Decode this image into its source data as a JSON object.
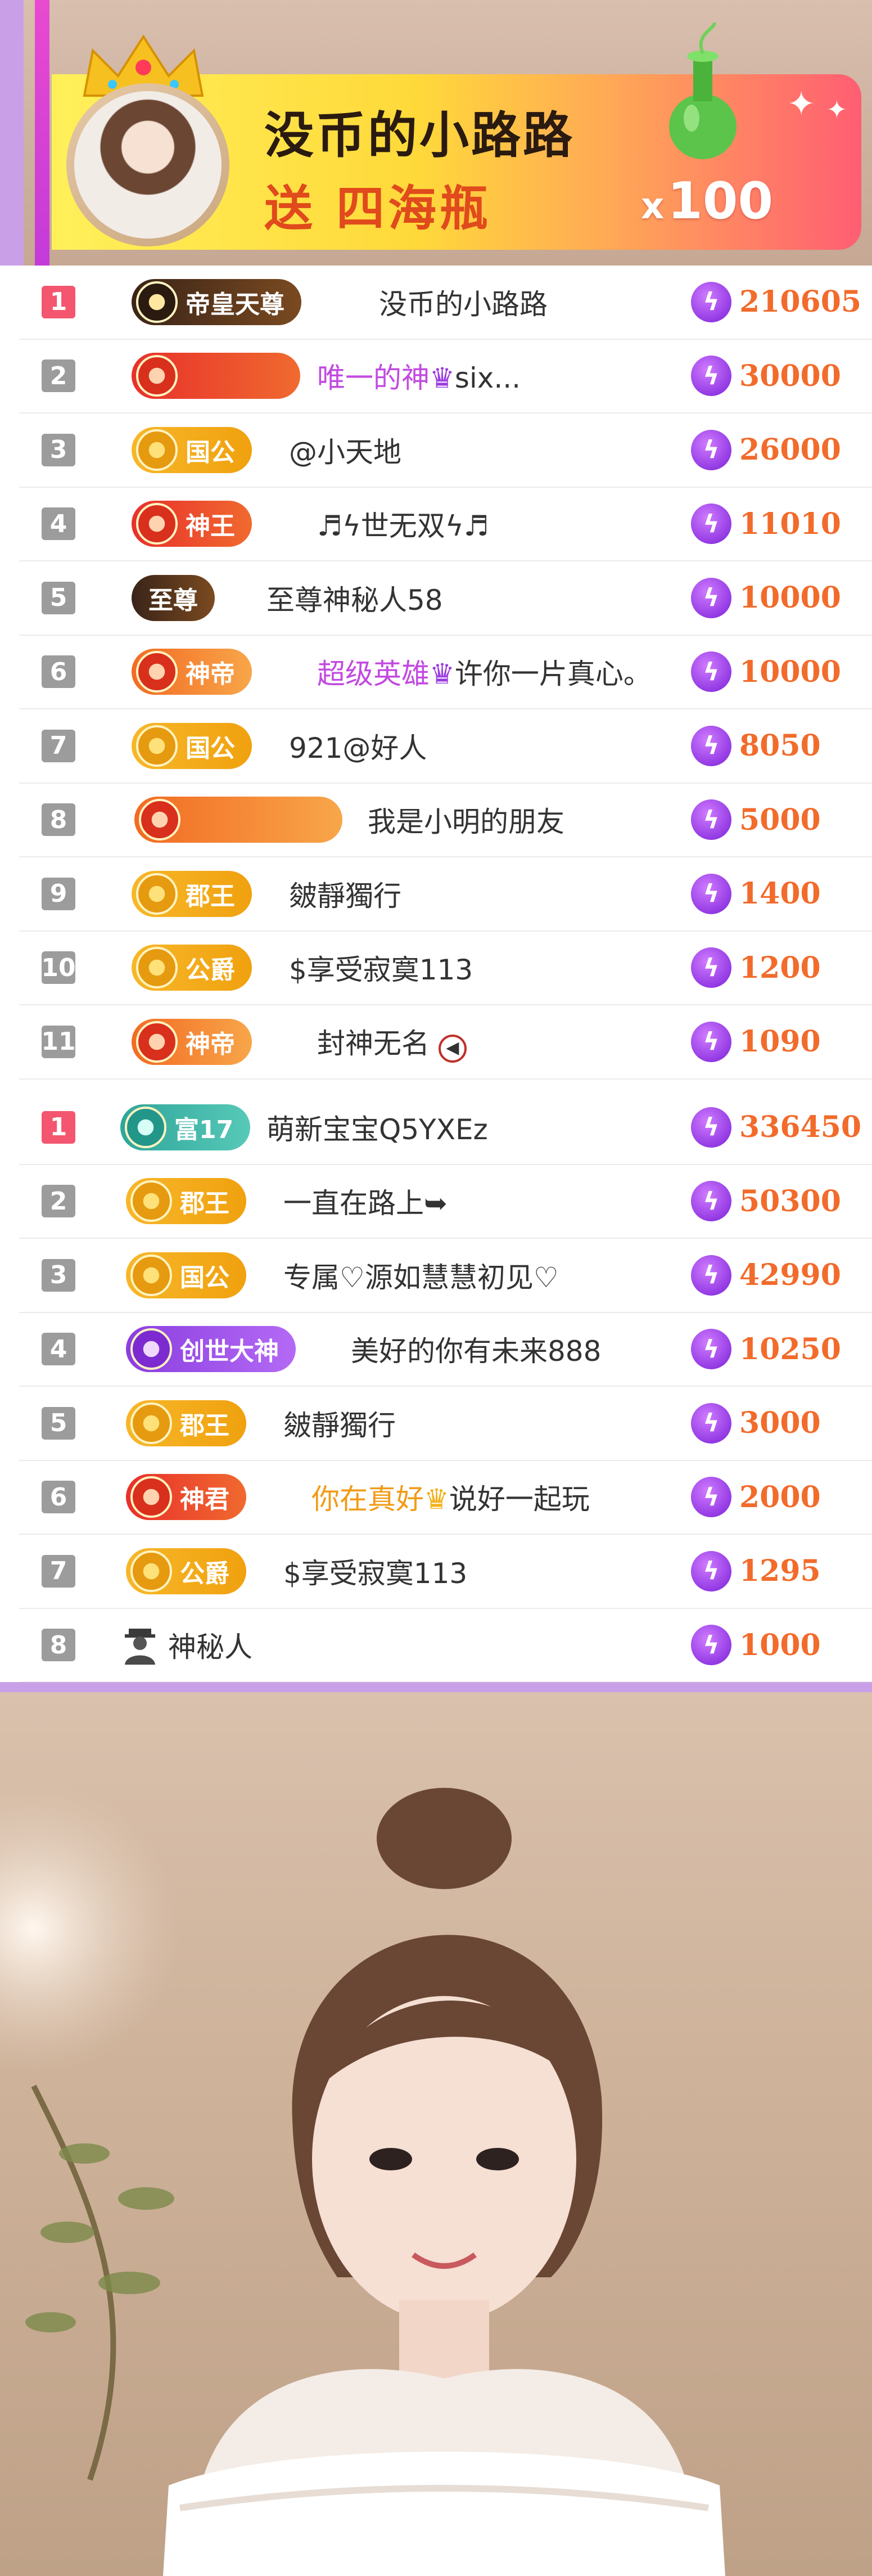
{
  "gift_banner": {
    "sender_name": "没币的小路路",
    "action_text": "送 四海瓶",
    "count_prefix": "x",
    "count": "100"
  },
  "list_a": [
    {
      "rank": "1",
      "badge": "帝皇天尊",
      "style": "b-dark",
      "name": "没币的小路路",
      "score": "210605"
    },
    {
      "rank": "2",
      "badge": "",
      "style": "b-red",
      "name_hl": "唯一的神",
      "name": "six...",
      "score": "30000"
    },
    {
      "rank": "3",
      "badge": "国公",
      "style": "b-gold",
      "name": "@小天地",
      "score": "26000"
    },
    {
      "rank": "4",
      "badge": "神王",
      "style": "b-red",
      "name": "♬ϟ世无双ϟ♬",
      "score": "11010"
    },
    {
      "rank": "5",
      "badge": "至尊",
      "style": "b-dark",
      "name": "至尊神秘人58",
      "score": "10000"
    },
    {
      "rank": "6",
      "badge": "神帝",
      "style": "b-orange",
      "name_hl": "超级英雄",
      "name": "许你一片真心。",
      "score": "10000"
    },
    {
      "rank": "7",
      "badge": "国公",
      "style": "b-gold",
      "name": "921@好人",
      "score": "8050"
    },
    {
      "rank": "8",
      "badge": "",
      "style": "b-orange",
      "name": "我是小明的朋友",
      "score": "5000"
    },
    {
      "rank": "9",
      "badge": "郡王",
      "style": "b-gold",
      "name": "皴靜獨行",
      "score": "1400"
    },
    {
      "rank": "10",
      "badge": "公爵",
      "style": "b-gold",
      "name": "$享受寂寞113",
      "score": "1200"
    },
    {
      "rank": "11",
      "badge": "神帝",
      "style": "b-orange",
      "name": "封神无名",
      "score": "1090"
    }
  ],
  "list_b": [
    {
      "rank": "1",
      "badge": "富17",
      "style": "b-teal",
      "name": "萌新宝宝Q5YXEz",
      "score": "336450"
    },
    {
      "rank": "2",
      "badge": "郡王",
      "style": "b-gold",
      "name": "一直在路上➥",
      "score": "50300"
    },
    {
      "rank": "3",
      "badge": "国公",
      "style": "b-gold",
      "name": "专属♡源如慧慧初见♡",
      "score": "42990"
    },
    {
      "rank": "4",
      "badge": "创世大神",
      "style": "b-purple",
      "name": "美好的你有未来888",
      "score": "10250"
    },
    {
      "rank": "5",
      "badge": "郡王",
      "style": "b-gold",
      "name": "皴靜獨行",
      "score": "3000"
    },
    {
      "rank": "6",
      "badge": "神君",
      "style": "b-red",
      "name_orange": "你在真好",
      "name": "说好一起玩",
      "score": "2000"
    },
    {
      "rank": "7",
      "badge": "公爵",
      "style": "b-gold",
      "name": "$享受寂寞113",
      "score": "1295"
    },
    {
      "rank": "8",
      "badge": "",
      "style": "",
      "name": "神秘人",
      "score": "1000"
    }
  ],
  "icons": {
    "score": "lightning-bolt-icon",
    "crown": "crown-icon",
    "vase": "vase-gift-icon",
    "mute": "mute-icon",
    "mystery": "mystery-person-icon"
  },
  "colors": {
    "rank_top": "#f4566f",
    "rank_other": "#9c9c9c",
    "score": "#f26b2b",
    "highlight_name": "#c24ae0",
    "accent_purple": "#c9a0e8"
  }
}
